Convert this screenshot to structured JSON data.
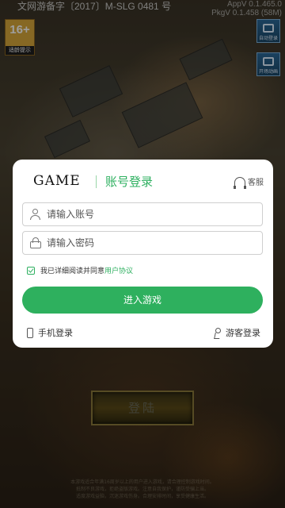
{
  "top_notice": "文网游备字〔2017〕M-SLG 0481 号",
  "versions": {
    "app": "AppV 0.1.465.0",
    "pkg": "PkgV 0.1.458 (58M)"
  },
  "age_badge": {
    "value": "16+",
    "label": "适龄提示"
  },
  "side_buttons": [
    "自动登录",
    "开场动画"
  ],
  "login": {
    "brand": "GAME",
    "title": "账号登录",
    "service_label": "客服",
    "account_placeholder": "请输入账号",
    "password_placeholder": "请输入密码",
    "agree_text": "我已详细阅读并同意",
    "agree_link": "用户协议",
    "enter_button": "进入游戏",
    "phone_login": "手机登录",
    "guest_login": "游客登录"
  },
  "game_login_button": "登陆",
  "footer_lines": [
    "本游戏适合年满16周岁以上的用户进入游戏，请合理控制游戏时间。",
    "抵制不良游戏，拒绝盗版游戏。注意自我保护，谨防受骗上当。",
    "适度游戏益脑，沉迷游戏伤身。合理安排时间，享受健康生活。"
  ],
  "colors": {
    "accent": "#2eb05e",
    "modal_bg": "#ffffff"
  }
}
